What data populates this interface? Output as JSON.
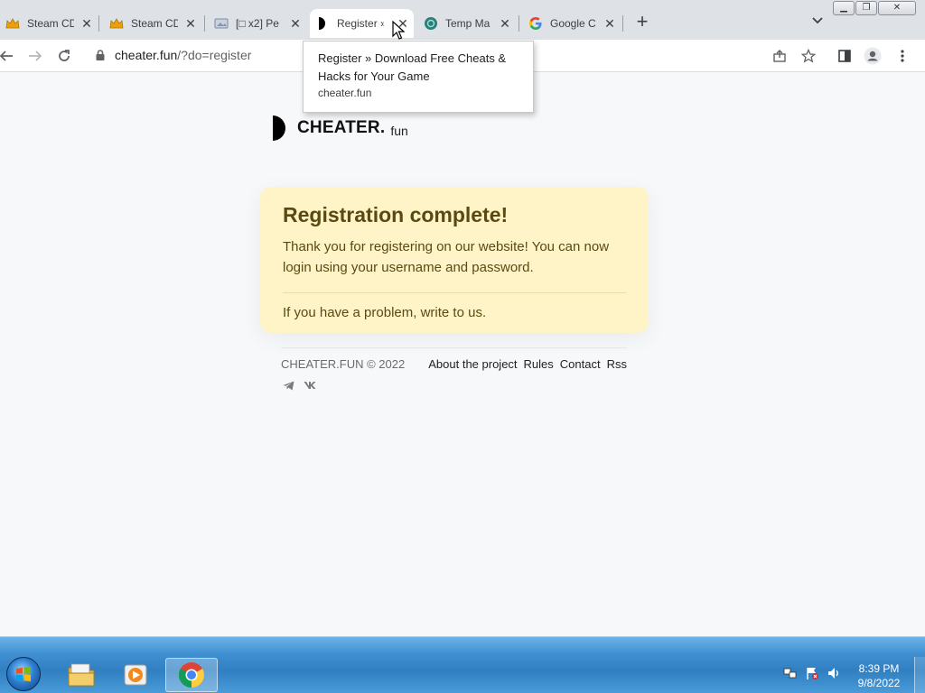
{
  "browser": {
    "tabs": [
      {
        "label": "Steam CD",
        "icon": "crown-icon"
      },
      {
        "label": "Steam CD",
        "icon": "crown-icon"
      },
      {
        "label": "[□ x2] Pe",
        "icon": "image-icon"
      },
      {
        "label": "Register »",
        "icon": "half-circle-logo-icon"
      },
      {
        "label": "Temp Ma",
        "icon": "temp-mail-icon"
      },
      {
        "label": "Google C",
        "icon": "google-icon"
      }
    ],
    "active_tab_index": 3,
    "address": {
      "host": "cheater.fun",
      "path": "/?do=register"
    },
    "tooltip": {
      "title": "Register » Download Free Cheats & Hacks for Your Game",
      "domain": "cheater.fun"
    }
  },
  "page": {
    "logo": {
      "brand": "CHEATER.",
      "tld": "fun"
    },
    "card": {
      "title": "Registration complete!",
      "message": "Thank you for registering on our website! You can now login using your username and password.",
      "help": "If you have a problem, write to us."
    },
    "footer": {
      "copyright": "CHEATER.FUN © 2022",
      "links": [
        "About the project",
        "Rules",
        "Contact",
        "Rss"
      ]
    }
  },
  "taskbar": {
    "apps": [
      "explorer-icon",
      "media-player-icon",
      "chrome-icon"
    ],
    "clock": {
      "time": "8:39 PM",
      "date": "9/8/2022"
    }
  },
  "colors": {
    "card_bg": "#fff3c8",
    "card_text": "#5a4a12",
    "tabstrip": "#dee1e6",
    "taskbar": "#3f8fd1"
  }
}
